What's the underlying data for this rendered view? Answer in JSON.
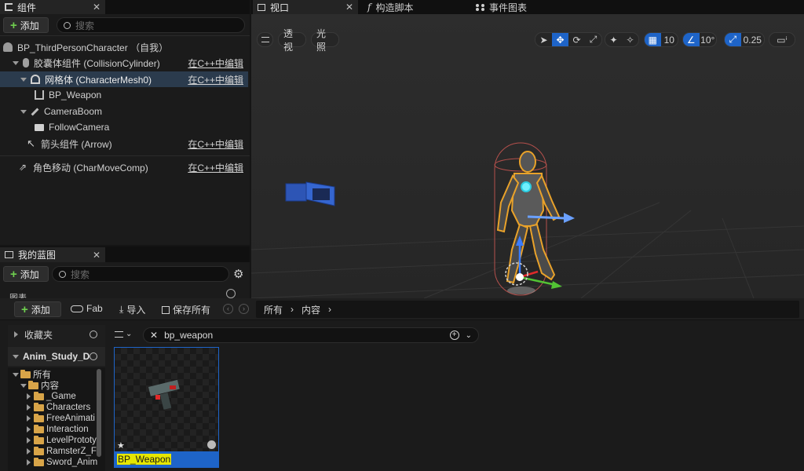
{
  "components_panel": {
    "tab_label": "组件",
    "add_label": "添加",
    "search_placeholder": "搜索",
    "tree": [
      {
        "label": "BP_ThirdPersonCharacter （自我）",
        "edit": ""
      },
      {
        "label": "胶囊体组件 (CollisionCylinder)",
        "edit": "在C++中编辑"
      },
      {
        "label": "网格体 (CharacterMesh0)",
        "edit": "在C++中编辑"
      },
      {
        "label": "BP_Weapon",
        "edit": ""
      },
      {
        "label": "CameraBoom",
        "edit": ""
      },
      {
        "label": "FollowCamera",
        "edit": ""
      },
      {
        "label": "箭头组件 (Arrow)",
        "edit": "在C++中编辑"
      },
      {
        "label": "角色移动 (CharMoveComp)",
        "edit": "在C++中编辑"
      }
    ]
  },
  "my_blueprint_panel": {
    "tab_label": "我的蓝图",
    "add_label": "添加",
    "search_placeholder": "搜索",
    "partial_section": "图表"
  },
  "editor_tabs": [
    {
      "label": "视口"
    },
    {
      "label": "构造脚本"
    },
    {
      "label": "事件图表"
    }
  ],
  "viewport": {
    "perspective_label": "透视",
    "lighting_label": "光照",
    "grid_snap_value": "10",
    "rotation_snap_value": "10°",
    "scale_snap_value": "0.25"
  },
  "content_browser": {
    "add_label": "添加",
    "fab_label": "Fab",
    "import_label": "导入",
    "save_all_label": "保存所有",
    "breadcrumb": [
      "所有",
      "内容"
    ],
    "favorites_label": "收藏夹",
    "project_label": "Anim_Study_D",
    "filter_text": "bp_weapon",
    "folders": [
      {
        "label": "所有",
        "level": 0
      },
      {
        "label": "内容",
        "level": 1
      },
      {
        "label": "_Game",
        "level": 2
      },
      {
        "label": "Characters",
        "level": 2
      },
      {
        "label": "FreeAnimati",
        "level": 2
      },
      {
        "label": "Interaction",
        "level": 2
      },
      {
        "label": "LevelPrototy",
        "level": 2
      },
      {
        "label": "RamsterZ_F",
        "level": 2
      },
      {
        "label": "Sword_Anim",
        "level": 2
      }
    ],
    "assets": [
      {
        "name": "BP_Weapon"
      }
    ]
  },
  "colors": {
    "accent_blue": "#1e64c8",
    "selection": "#2b3b4d",
    "folder": "#d8a448",
    "add_green": "#6fcf4f",
    "highlight_yellow": "#e6e600"
  }
}
